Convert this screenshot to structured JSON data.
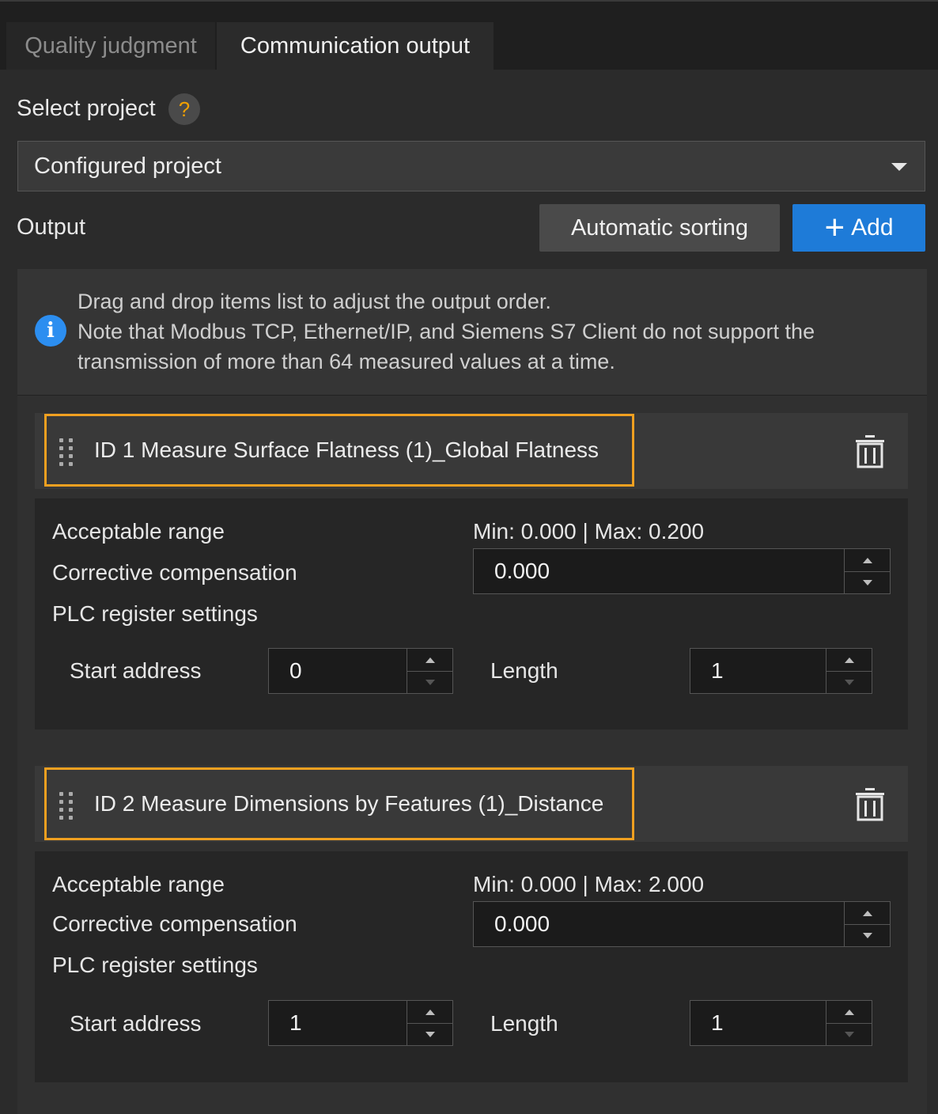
{
  "tabs": [
    {
      "label": "Quality judgment",
      "active": false
    },
    {
      "label": "Communication output",
      "active": true
    }
  ],
  "select_project": {
    "label": "Select project",
    "help_icon": "help-icon",
    "value": "Configured project"
  },
  "output": {
    "label": "Output",
    "sort_button": "Automatic sorting",
    "add_button": "Add"
  },
  "notice": {
    "lines": [
      "Drag and drop items list to adjust the output order.",
      "Note that Modbus TCP, Ethernet/IP, and Siemens S7 Client do not support the",
      "transmission of more than 64 measured values at a time."
    ]
  },
  "items": [
    {
      "title": "ID 1  Measure Surface Flatness (1)_Global Flatness",
      "acceptable_range_label": "Acceptable range",
      "acceptable_range_value": "Min: 0.000 | Max: 0.200",
      "compensation_label": "Corrective compensation",
      "compensation_value": "0.000",
      "plc_label": "PLC register settings",
      "start_address_label": "Start address",
      "start_address_value": "0",
      "length_label": "Length",
      "length_value": "1"
    },
    {
      "title": "ID 2  Measure Dimensions by Features (1)_Distance",
      "acceptable_range_label": "Acceptable range",
      "acceptable_range_value": "Min: 0.000 | Max: 2.000",
      "compensation_label": "Corrective compensation",
      "compensation_value": "0.000",
      "plc_label": "PLC register settings",
      "start_address_label": "Start address",
      "start_address_value": "1",
      "length_label": "Length",
      "length_value": "1"
    }
  ],
  "colors": {
    "accent_blue": "#1e7bd8",
    "highlight_orange": "#f0a020",
    "info_blue": "#2c8ef0"
  }
}
